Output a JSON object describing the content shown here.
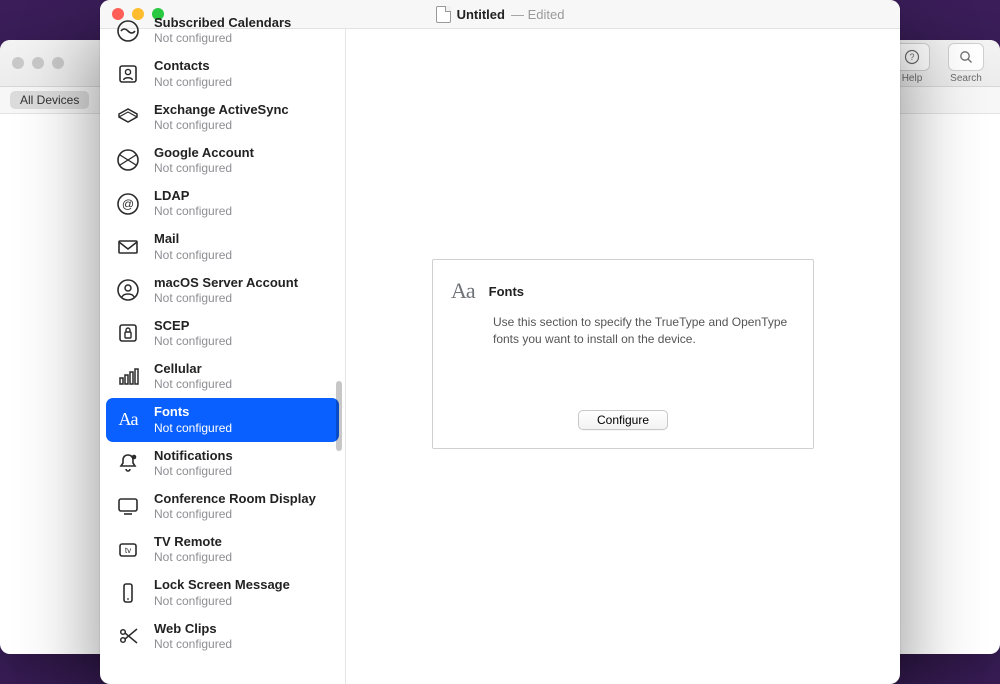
{
  "back_window": {
    "toolbar": {
      "help_label": "Help",
      "search_label": "Search"
    },
    "subbar": {
      "pill": "All Devices"
    }
  },
  "front_window": {
    "title": {
      "name": "Untitled",
      "suffix": "— Edited"
    }
  },
  "sidebar": {
    "items": [
      {
        "id": "subscribed-calendars",
        "title": "Subscribed Calendars",
        "sub": "Not configured",
        "icon": "calendar-subscribe-icon"
      },
      {
        "id": "contacts",
        "title": "Contacts",
        "sub": "Not configured",
        "icon": "contacts-icon"
      },
      {
        "id": "exchange",
        "title": "Exchange ActiveSync",
        "sub": "Not configured",
        "icon": "exchange-icon"
      },
      {
        "id": "google",
        "title": "Google Account",
        "sub": "Not configured",
        "icon": "google-account-icon"
      },
      {
        "id": "ldap",
        "title": "LDAP",
        "sub": "Not configured",
        "icon": "ldap-icon"
      },
      {
        "id": "mail",
        "title": "Mail",
        "sub": "Not configured",
        "icon": "mail-icon"
      },
      {
        "id": "macos-server",
        "title": "macOS Server Account",
        "sub": "Not configured",
        "icon": "server-account-icon"
      },
      {
        "id": "scep",
        "title": "SCEP",
        "sub": "Not configured",
        "icon": "lock-icon"
      },
      {
        "id": "cellular",
        "title": "Cellular",
        "sub": "Not configured",
        "icon": "cellular-icon"
      },
      {
        "id": "fonts",
        "title": "Fonts",
        "sub": "Not configured",
        "icon": "fonts-icon",
        "selected": true
      },
      {
        "id": "notifications",
        "title": "Notifications",
        "sub": "Not configured",
        "icon": "bell-icon"
      },
      {
        "id": "conference-room",
        "title": "Conference Room Display",
        "sub": "Not configured",
        "icon": "display-icon"
      },
      {
        "id": "tv-remote",
        "title": "TV Remote",
        "sub": "Not configured",
        "icon": "tv-remote-icon"
      },
      {
        "id": "lock-screen",
        "title": "Lock Screen Message",
        "sub": "Not configured",
        "icon": "phone-icon"
      },
      {
        "id": "web-clips",
        "title": "Web Clips",
        "sub": "Not configured",
        "icon": "scissors-icon"
      }
    ]
  },
  "detail": {
    "title": "Fonts",
    "description": "Use this section to specify the TrueType and OpenType fonts you want to install on the device.",
    "configure_label": "Configure",
    "icon_glyph": "Aa"
  }
}
